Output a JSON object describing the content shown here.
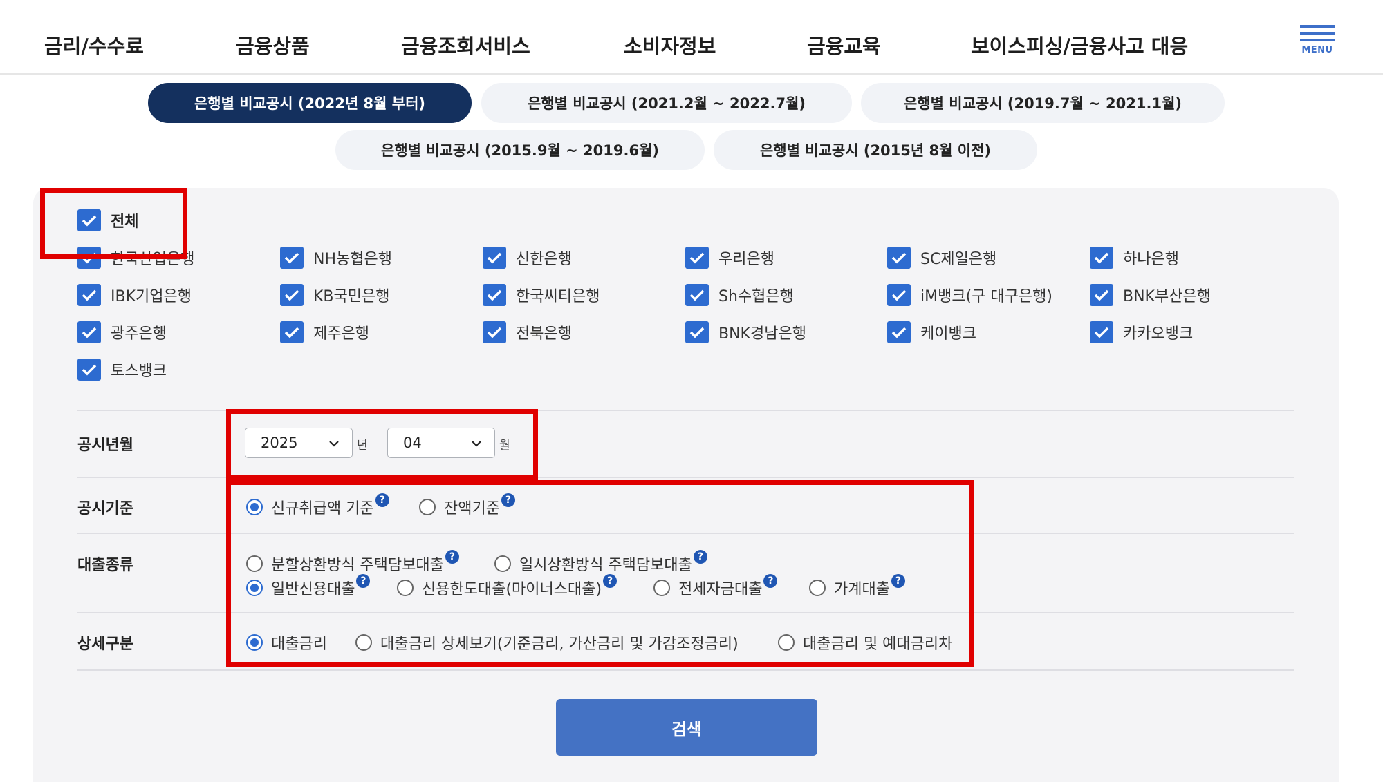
{
  "nav": {
    "items": [
      "금리/수수료",
      "금융상품",
      "금융조회서비스",
      "소비자정보",
      "금융교육",
      "보이스피싱/금융사고 대응"
    ],
    "menu_label": "MENU"
  },
  "tabs": [
    {
      "label": "은행별 비교공시 (2022년 8월 부터)",
      "active": true
    },
    {
      "label": "은행별 비교공시 (2021.2월 ~ 2022.7월)",
      "active": false
    },
    {
      "label": "은행별 비교공시 (2019.7월 ~ 2021.1월)",
      "active": false
    },
    {
      "label": "은행별 비교공시 (2015.9월 ~ 2019.6월)",
      "active": false
    },
    {
      "label": "은행별 비교공시 (2015년 8월 이전)",
      "active": false
    }
  ],
  "banks": {
    "all_label": "전체",
    "items": [
      "한국산업은행",
      "NH농협은행",
      "신한은행",
      "우리은행",
      "SC제일은행",
      "하나은행",
      "IBK기업은행",
      "KB국민은행",
      "한국씨티은행",
      "Sh수협은행",
      "iM뱅크(구 대구은행)",
      "BNK부산은행",
      "광주은행",
      "제주은행",
      "전북은행",
      "BNK경남은행",
      "케이뱅크",
      "카카오뱅크",
      "토스뱅크"
    ]
  },
  "period": {
    "label": "공시년월",
    "year_value": "2025",
    "year_unit": "년",
    "month_value": "04",
    "month_unit": "월"
  },
  "basis": {
    "label": "공시기준",
    "options": [
      "신규취급액 기준",
      "잔액기준"
    ],
    "selected": "신규취급액 기준"
  },
  "loan_type": {
    "label": "대출종류",
    "options": [
      "분할상환방식 주택담보대출",
      "일시상환방식 주택담보대출",
      "일반신용대출",
      "신용한도대출(마이너스대출)",
      "전세자금대출",
      "가계대출"
    ],
    "selected": "일반신용대출"
  },
  "detail": {
    "label": "상세구분",
    "options": [
      "대출금리",
      "대출금리 상세보기(기준금리, 가산금리 및 가감조정금리)",
      "대출금리 및 예대금리차"
    ],
    "selected": "대출금리"
  },
  "help_glyph": "?",
  "search_label": "검색",
  "colors": {
    "accent": "#2d6bd0",
    "active_tab": "#14305e",
    "search_button": "#4472c4",
    "highlight_box": "#e00000"
  }
}
